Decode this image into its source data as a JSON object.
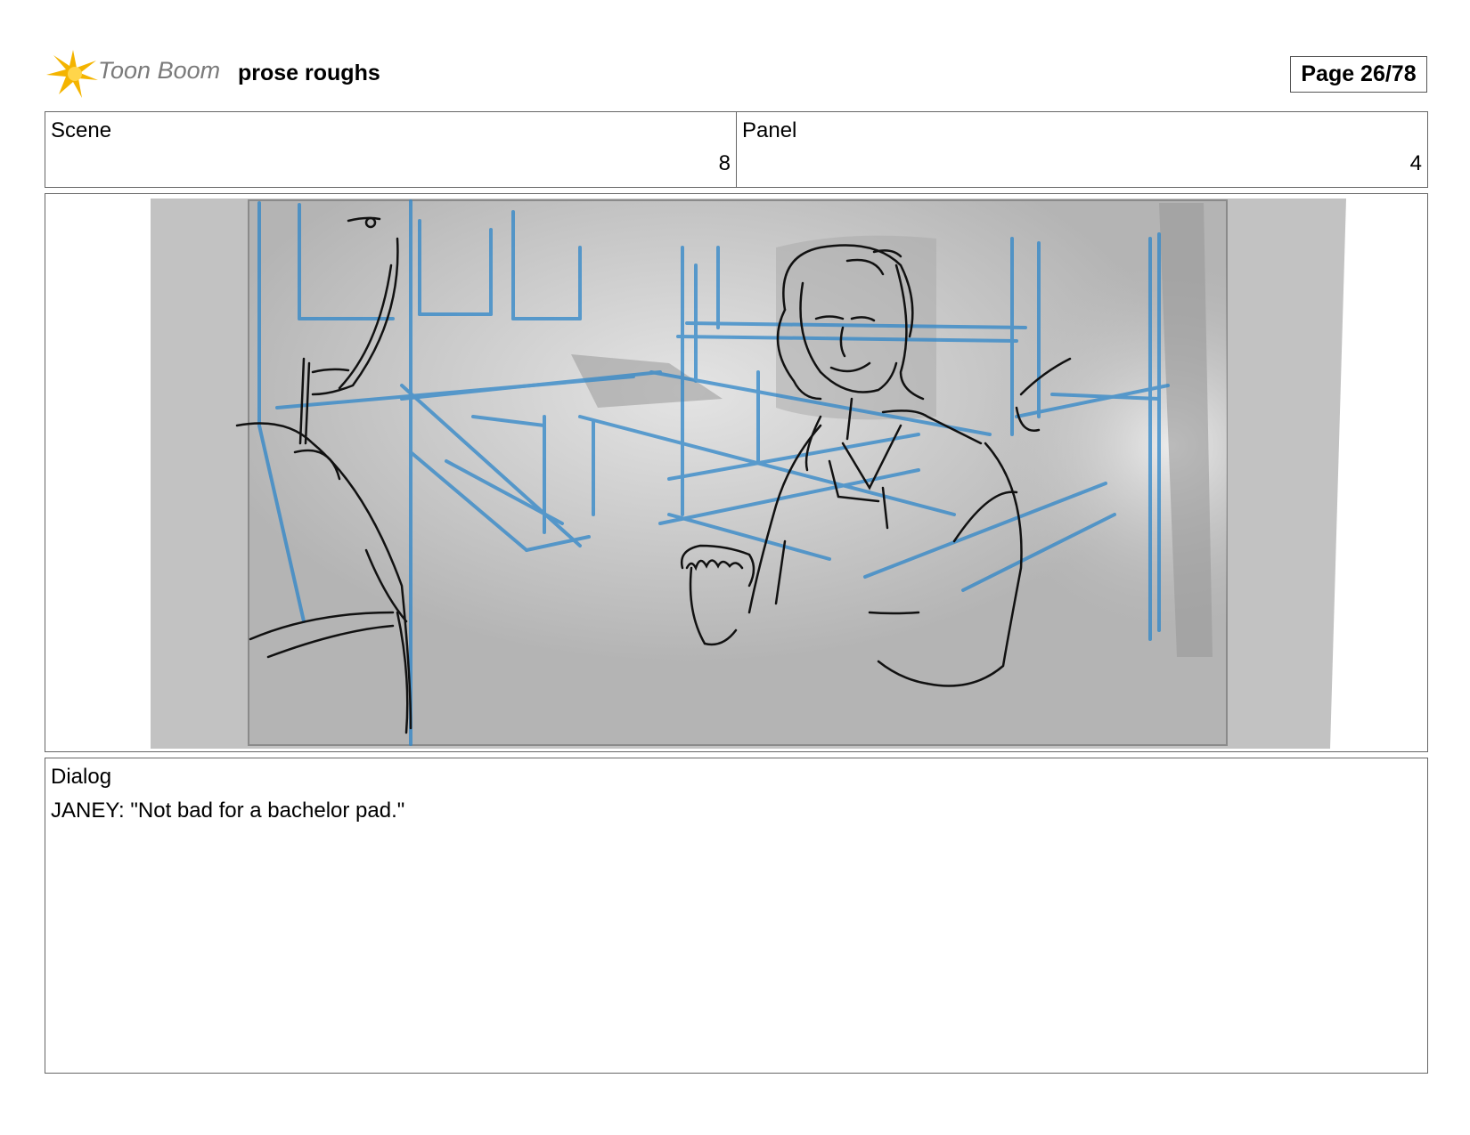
{
  "header": {
    "logo_text": "Toon Boom",
    "title": "prose roughs",
    "page": "Page 26/78"
  },
  "info": {
    "scene_label": "Scene",
    "scene_value": "8",
    "panel_label": "Panel",
    "panel_value": "4"
  },
  "dialog": {
    "label": "Dialog",
    "text": "JANEY: \"Not bad for a bachelor pad.\""
  },
  "colors": {
    "perspective_lines": "#2e86c9",
    "sketch_ink": "#111111",
    "logo_star": "#f4b400"
  }
}
